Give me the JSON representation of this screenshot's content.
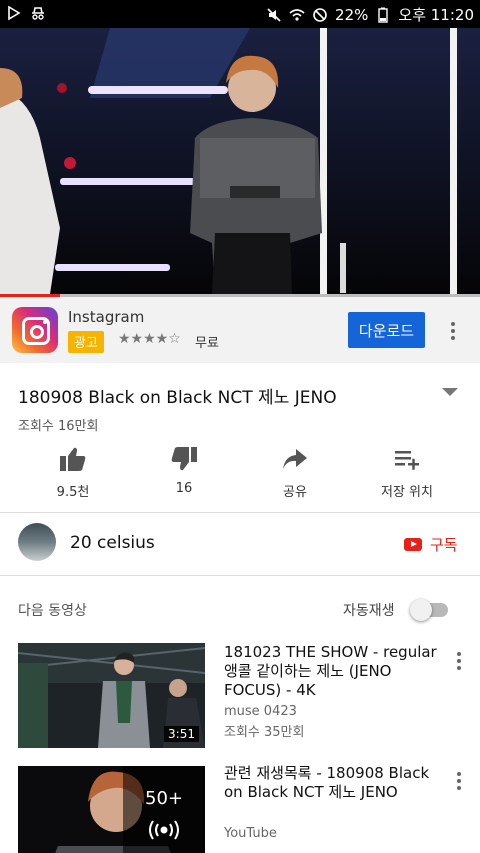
{
  "status_bar": {
    "battery": "22%",
    "time": "오후 11:20"
  },
  "video": {
    "progress_fraction": 0.125
  },
  "ad": {
    "app_name": "Instagram",
    "badge": "광고",
    "rating_stars": "★★★★☆",
    "price": "무료",
    "cta": "다운로드"
  },
  "video_info": {
    "title": "180908 Black on Black NCT 제노 JENO",
    "views": "조회수 16만회"
  },
  "actions": [
    {
      "icon": "thumbs-up-icon",
      "label": "9.5천"
    },
    {
      "icon": "thumbs-down-icon",
      "label": "16"
    },
    {
      "icon": "share-icon",
      "label": "공유"
    },
    {
      "icon": "add-to-playlist-icon",
      "label": "저장 위치"
    }
  ],
  "channel": {
    "name": "20 celsius",
    "subscribe_label": "구독"
  },
  "up_next": {
    "label": "다음 동영상",
    "autoplay_label": "자동재생",
    "autoplay_on": false
  },
  "videos": [
    {
      "title": "181023 THE SHOW - regular 앵콜 같이하는 제노 (JENO FOCUS) - 4K",
      "channel": "muse 0423",
      "views": "조회수 35만회",
      "duration": "3:51"
    },
    {
      "title": "관련 재생목록 - 180908 Black on Black NCT 제노 JENO",
      "channel": "YouTube",
      "playlist_count": "50+"
    }
  ],
  "colors": {
    "accent_red": "#e62117",
    "cta_blue": "#1565d8",
    "ad_badge": "#f5b400"
  }
}
